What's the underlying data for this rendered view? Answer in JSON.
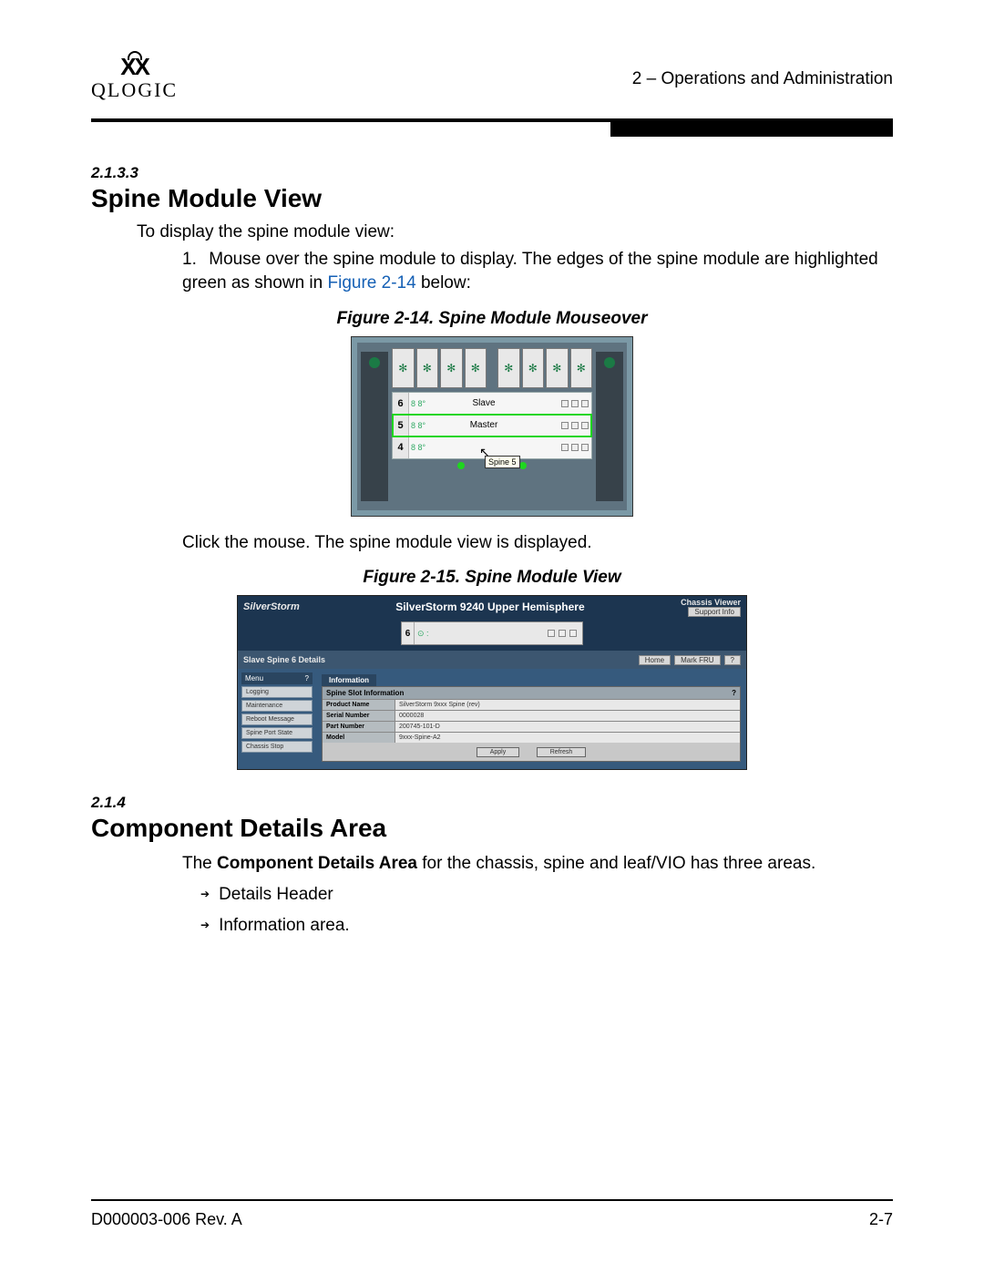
{
  "header": {
    "logo_text": "QLOGIC",
    "chapter": "2 – Operations and Administration"
  },
  "section1": {
    "number": "2.1.3.3",
    "title": "Spine Module View",
    "intro": "To display the spine module view:",
    "step1_num": "1.",
    "step1_a": "Mouse over the spine module to display. The edges of the spine module are highlighted green as shown in ",
    "step1_link": "Figure 2-14",
    "step1_b": " below:"
  },
  "figure1": {
    "caption": "Figure 2-14. Spine Module Mouseover",
    "slots": [
      {
        "num": "6",
        "icons": "8 8°",
        "label": "Slave"
      },
      {
        "num": "5",
        "icons": "8 8°",
        "label": "Master"
      },
      {
        "num": "4",
        "icons": "8 8°",
        "label": ""
      }
    ],
    "tooltip": "Spine 5"
  },
  "post_fig1": "Click the mouse. The spine module view is displayed.",
  "figure2": {
    "caption": "Figure 2-15. Spine Module View",
    "logo": "SilverStorm",
    "product_title": "SilverStorm 9240 Upper Hemisphere",
    "corner": "Chassis Viewer",
    "support_btn": "Support Info",
    "module_num": "6",
    "crumb": "Slave Spine 6 Details",
    "crumb_home": "Home",
    "crumb_view": "Mark FRU",
    "menu_header": "Menu",
    "menu_items": [
      "Logging",
      "Maintenance",
      "Reboot Message",
      "Spine Port State",
      "Chassis Stop"
    ],
    "info_tab": "Information",
    "panel_header": "Spine Slot Information",
    "rows": [
      {
        "k": "Product Name",
        "v": "SilverStorm 9xxx Spine (rev)"
      },
      {
        "k": "Serial Number",
        "v": "0000028"
      },
      {
        "k": "Part Number",
        "v": "200745-101-D"
      },
      {
        "k": "Model",
        "v": "9xxx-Spine-A2"
      }
    ],
    "btn_apply": "Apply",
    "btn_refresh": "Refresh"
  },
  "section2": {
    "number": "2.1.4",
    "title": "Component Details Area",
    "body_a": "The ",
    "body_b": "Component Details Area",
    "body_c": " for the chassis, spine and leaf/VIO has three areas.",
    "bullets": [
      "Details Header",
      "Information area."
    ]
  },
  "footer": {
    "doc": "D000003-006 Rev. A",
    "page": "2-7"
  }
}
